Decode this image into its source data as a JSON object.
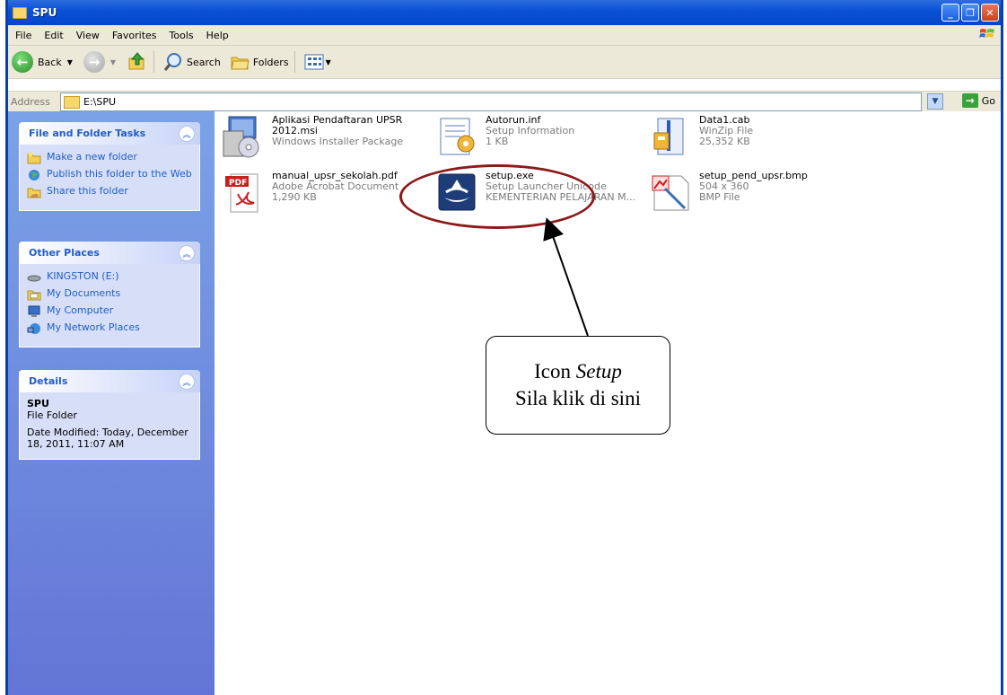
{
  "window": {
    "title": "SPU"
  },
  "menu": [
    {
      "label": "File",
      "key": "F"
    },
    {
      "label": "Edit",
      "key": "E"
    },
    {
      "label": "View",
      "key": "V"
    },
    {
      "label": "Favorites",
      "key": "a"
    },
    {
      "label": "Tools",
      "key": "T"
    },
    {
      "label": "Help",
      "key": "H"
    }
  ],
  "toolbar": {
    "back": "Back",
    "search": "Search",
    "folders": "Folders"
  },
  "address": {
    "label": "Address",
    "value": "E:\\SPU",
    "go": "Go"
  },
  "sidebar": {
    "tasks": {
      "title": "File and Folder Tasks",
      "items": [
        "Make a new folder",
        "Publish this folder to the Web",
        "Share this folder"
      ]
    },
    "places": {
      "title": "Other Places",
      "items": [
        "KINGSTON (E:)",
        "My Documents",
        "My Computer",
        "My Network Places"
      ]
    },
    "details": {
      "title": "Details",
      "name": "SPU",
      "type": "File Folder",
      "modified": "Date Modified: Today, December 18, 2011, 11:07 AM"
    }
  },
  "files": [
    {
      "name": "Aplikasi Pendaftaran UPSR 2012.msi",
      "line1": "Windows Installer Package",
      "line2": "",
      "icon": "installer-icon"
    },
    {
      "name": "Autorun.inf",
      "line1": "Setup Information",
      "line2": "1 KB",
      "icon": "setup-info-icon"
    },
    {
      "name": "Data1.cab",
      "line1": "WinZip File",
      "line2": "25,352 KB",
      "icon": "winzip-icon"
    },
    {
      "name": "manual_upsr_sekolah.pdf",
      "line1": "Adobe Acrobat Document",
      "line2": "1,290 KB",
      "icon": "pdf-icon"
    },
    {
      "name": "setup.exe",
      "line1": "Setup Launcher Unicode",
      "line2": "KEMENTERIAN PELAJARAN M...",
      "icon": "setup-exe-icon"
    },
    {
      "name": "setup_pend_upsr.bmp",
      "line1": "504 x 360",
      "line2": "BMP File",
      "icon": "bmp-icon"
    }
  ],
  "callout": {
    "line1_prefix": "Icon ",
    "line1_italic": "Setup",
    "line2": "Sila klik di sini"
  },
  "colors": {
    "titlebar": "#0b52d8",
    "sidebar": "#6d8ee0",
    "link": "#215dc6",
    "annotation": "#8b1a1a"
  }
}
